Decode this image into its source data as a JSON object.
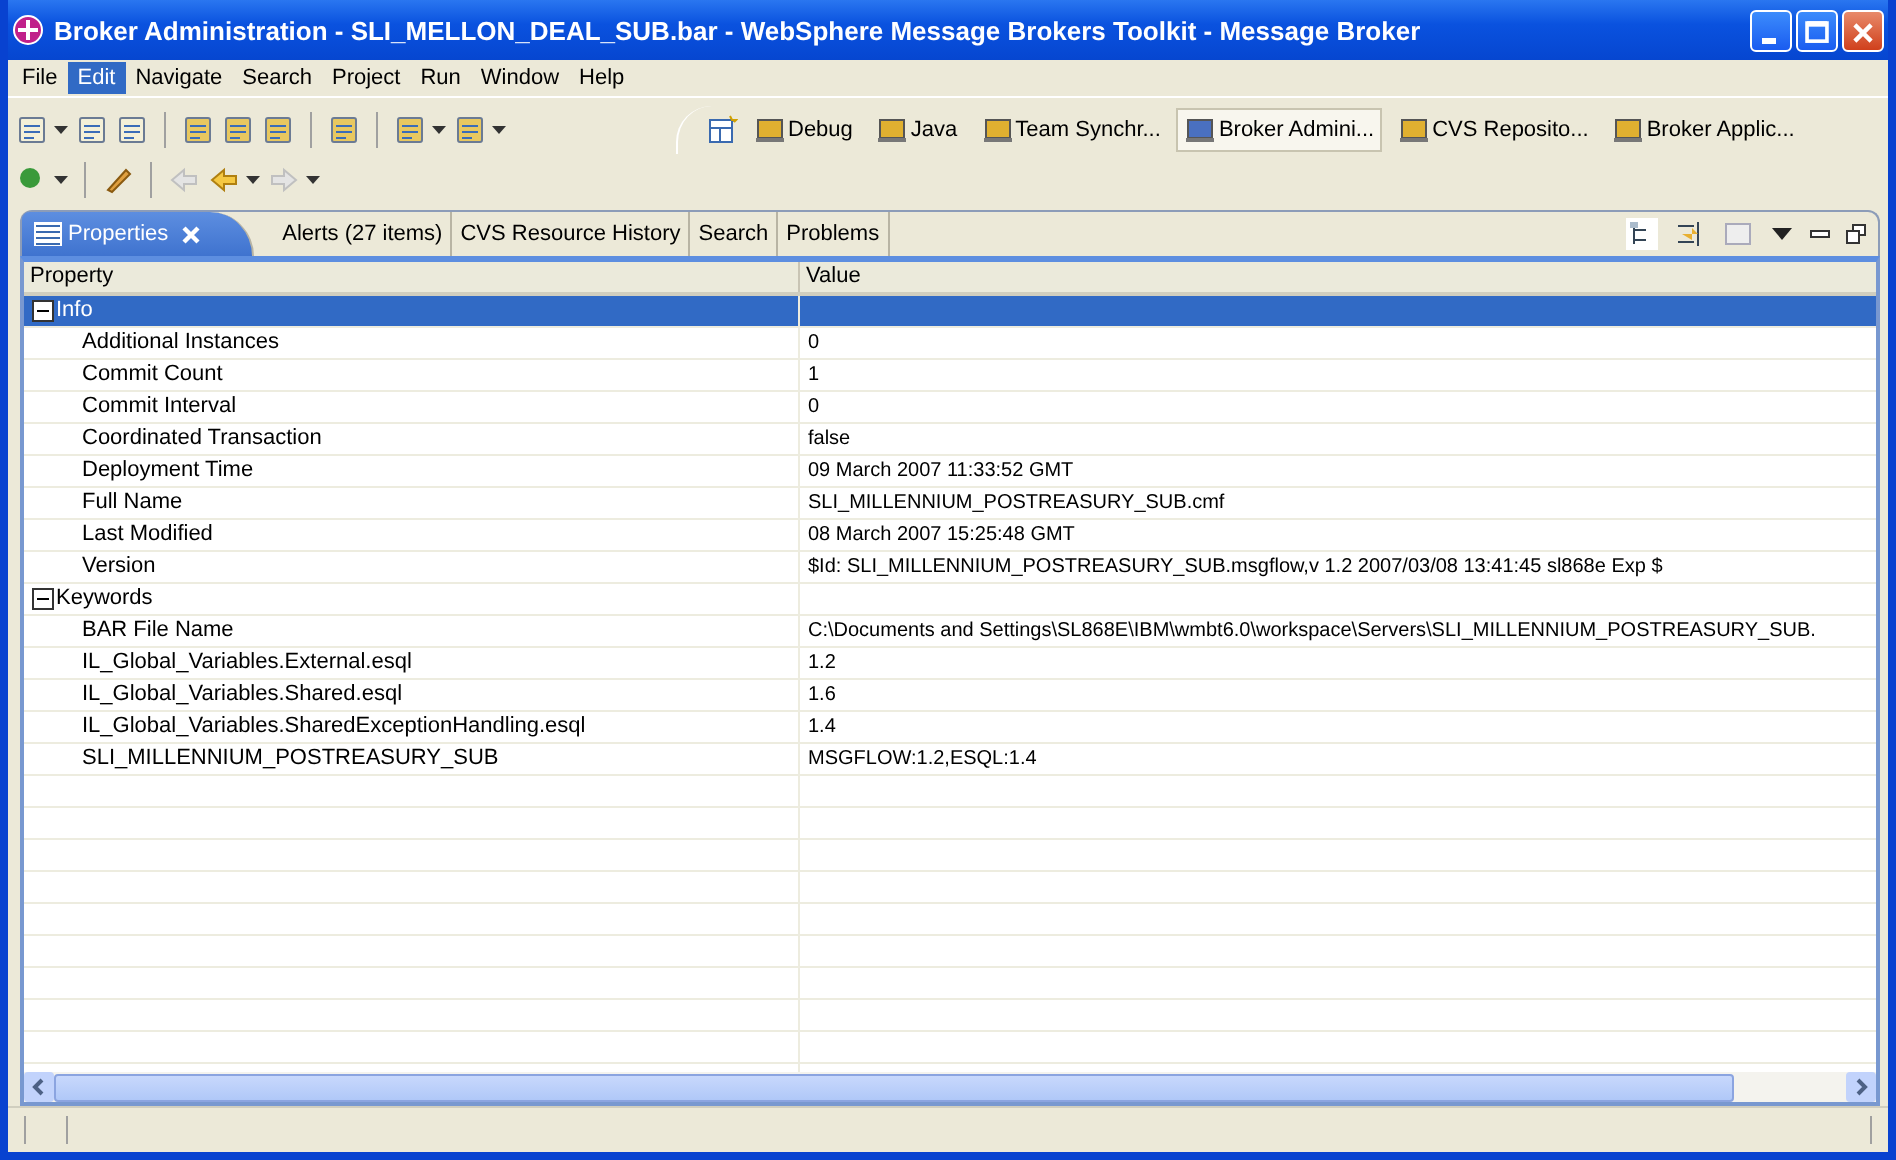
{
  "window": {
    "title": "Broker Administration - SLI_MELLON_DEAL_SUB.bar - WebSphere Message Brokers Toolkit - Message Broker"
  },
  "menu": [
    {
      "label": "File",
      "selected": false
    },
    {
      "label": "Edit",
      "selected": true
    },
    {
      "label": "Navigate",
      "selected": false
    },
    {
      "label": "Search",
      "selected": false
    },
    {
      "label": "Project",
      "selected": false
    },
    {
      "label": "Run",
      "selected": false
    },
    {
      "label": "Window",
      "selected": false
    },
    {
      "label": "Help",
      "selected": false
    }
  ],
  "perspectives": [
    {
      "label": "Debug",
      "selected": false
    },
    {
      "label": "Java",
      "selected": false
    },
    {
      "label": "Team Synchr...",
      "selected": false
    },
    {
      "label": "Broker Admini...",
      "selected": true
    },
    {
      "label": "CVS Reposito...",
      "selected": false
    },
    {
      "label": "Broker Applic...",
      "selected": false
    }
  ],
  "view_tabs": [
    {
      "label": "Properties",
      "selected": true
    },
    {
      "label": "Alerts (27 items)",
      "selected": false
    },
    {
      "label": "CVS Resource History",
      "selected": false
    },
    {
      "label": "Search",
      "selected": false
    },
    {
      "label": "Problems",
      "selected": false
    }
  ],
  "table": {
    "columns": [
      "Property",
      "Value"
    ],
    "groups": [
      {
        "name": "Info",
        "expanded": true,
        "selected": true,
        "rows": [
          {
            "property": "Additional Instances",
            "value": "0"
          },
          {
            "property": "Commit Count",
            "value": "1"
          },
          {
            "property": "Commit Interval",
            "value": "0"
          },
          {
            "property": "Coordinated Transaction",
            "value": "false"
          },
          {
            "property": "Deployment Time",
            "value": "09 March 2007 11:33:52 GMT"
          },
          {
            "property": "Full Name",
            "value": "SLI_MILLENNIUM_POSTREASURY_SUB.cmf"
          },
          {
            "property": "Last Modified",
            "value": "08 March 2007 15:25:48 GMT"
          },
          {
            "property": "Version",
            "value": "$Id: SLI_MILLENNIUM_POSTREASURY_SUB.msgflow,v 1.2 2007/03/08 13:41:45 sl868e Exp $"
          }
        ]
      },
      {
        "name": "Keywords",
        "expanded": true,
        "selected": false,
        "rows": [
          {
            "property": "BAR File Name",
            "value": "C:\\Documents and Settings\\SL868E\\IBM\\wmbt6.0\\workspace\\Servers\\SLI_MILLENNIUM_POSTREASURY_SUB."
          },
          {
            "property": "IL_Global_Variables.External.esql",
            "value": "1.2"
          },
          {
            "property": "IL_Global_Variables.Shared.esql",
            "value": "1.6"
          },
          {
            "property": "IL_Global_Variables.SharedExceptionHandling.esql",
            "value": "1.4"
          },
          {
            "property": "SLI_MILLENNIUM_POSTREASURY_SUB",
            "value": "MSGFLOW:1.2,ESQL:1.4"
          }
        ]
      }
    ]
  }
}
